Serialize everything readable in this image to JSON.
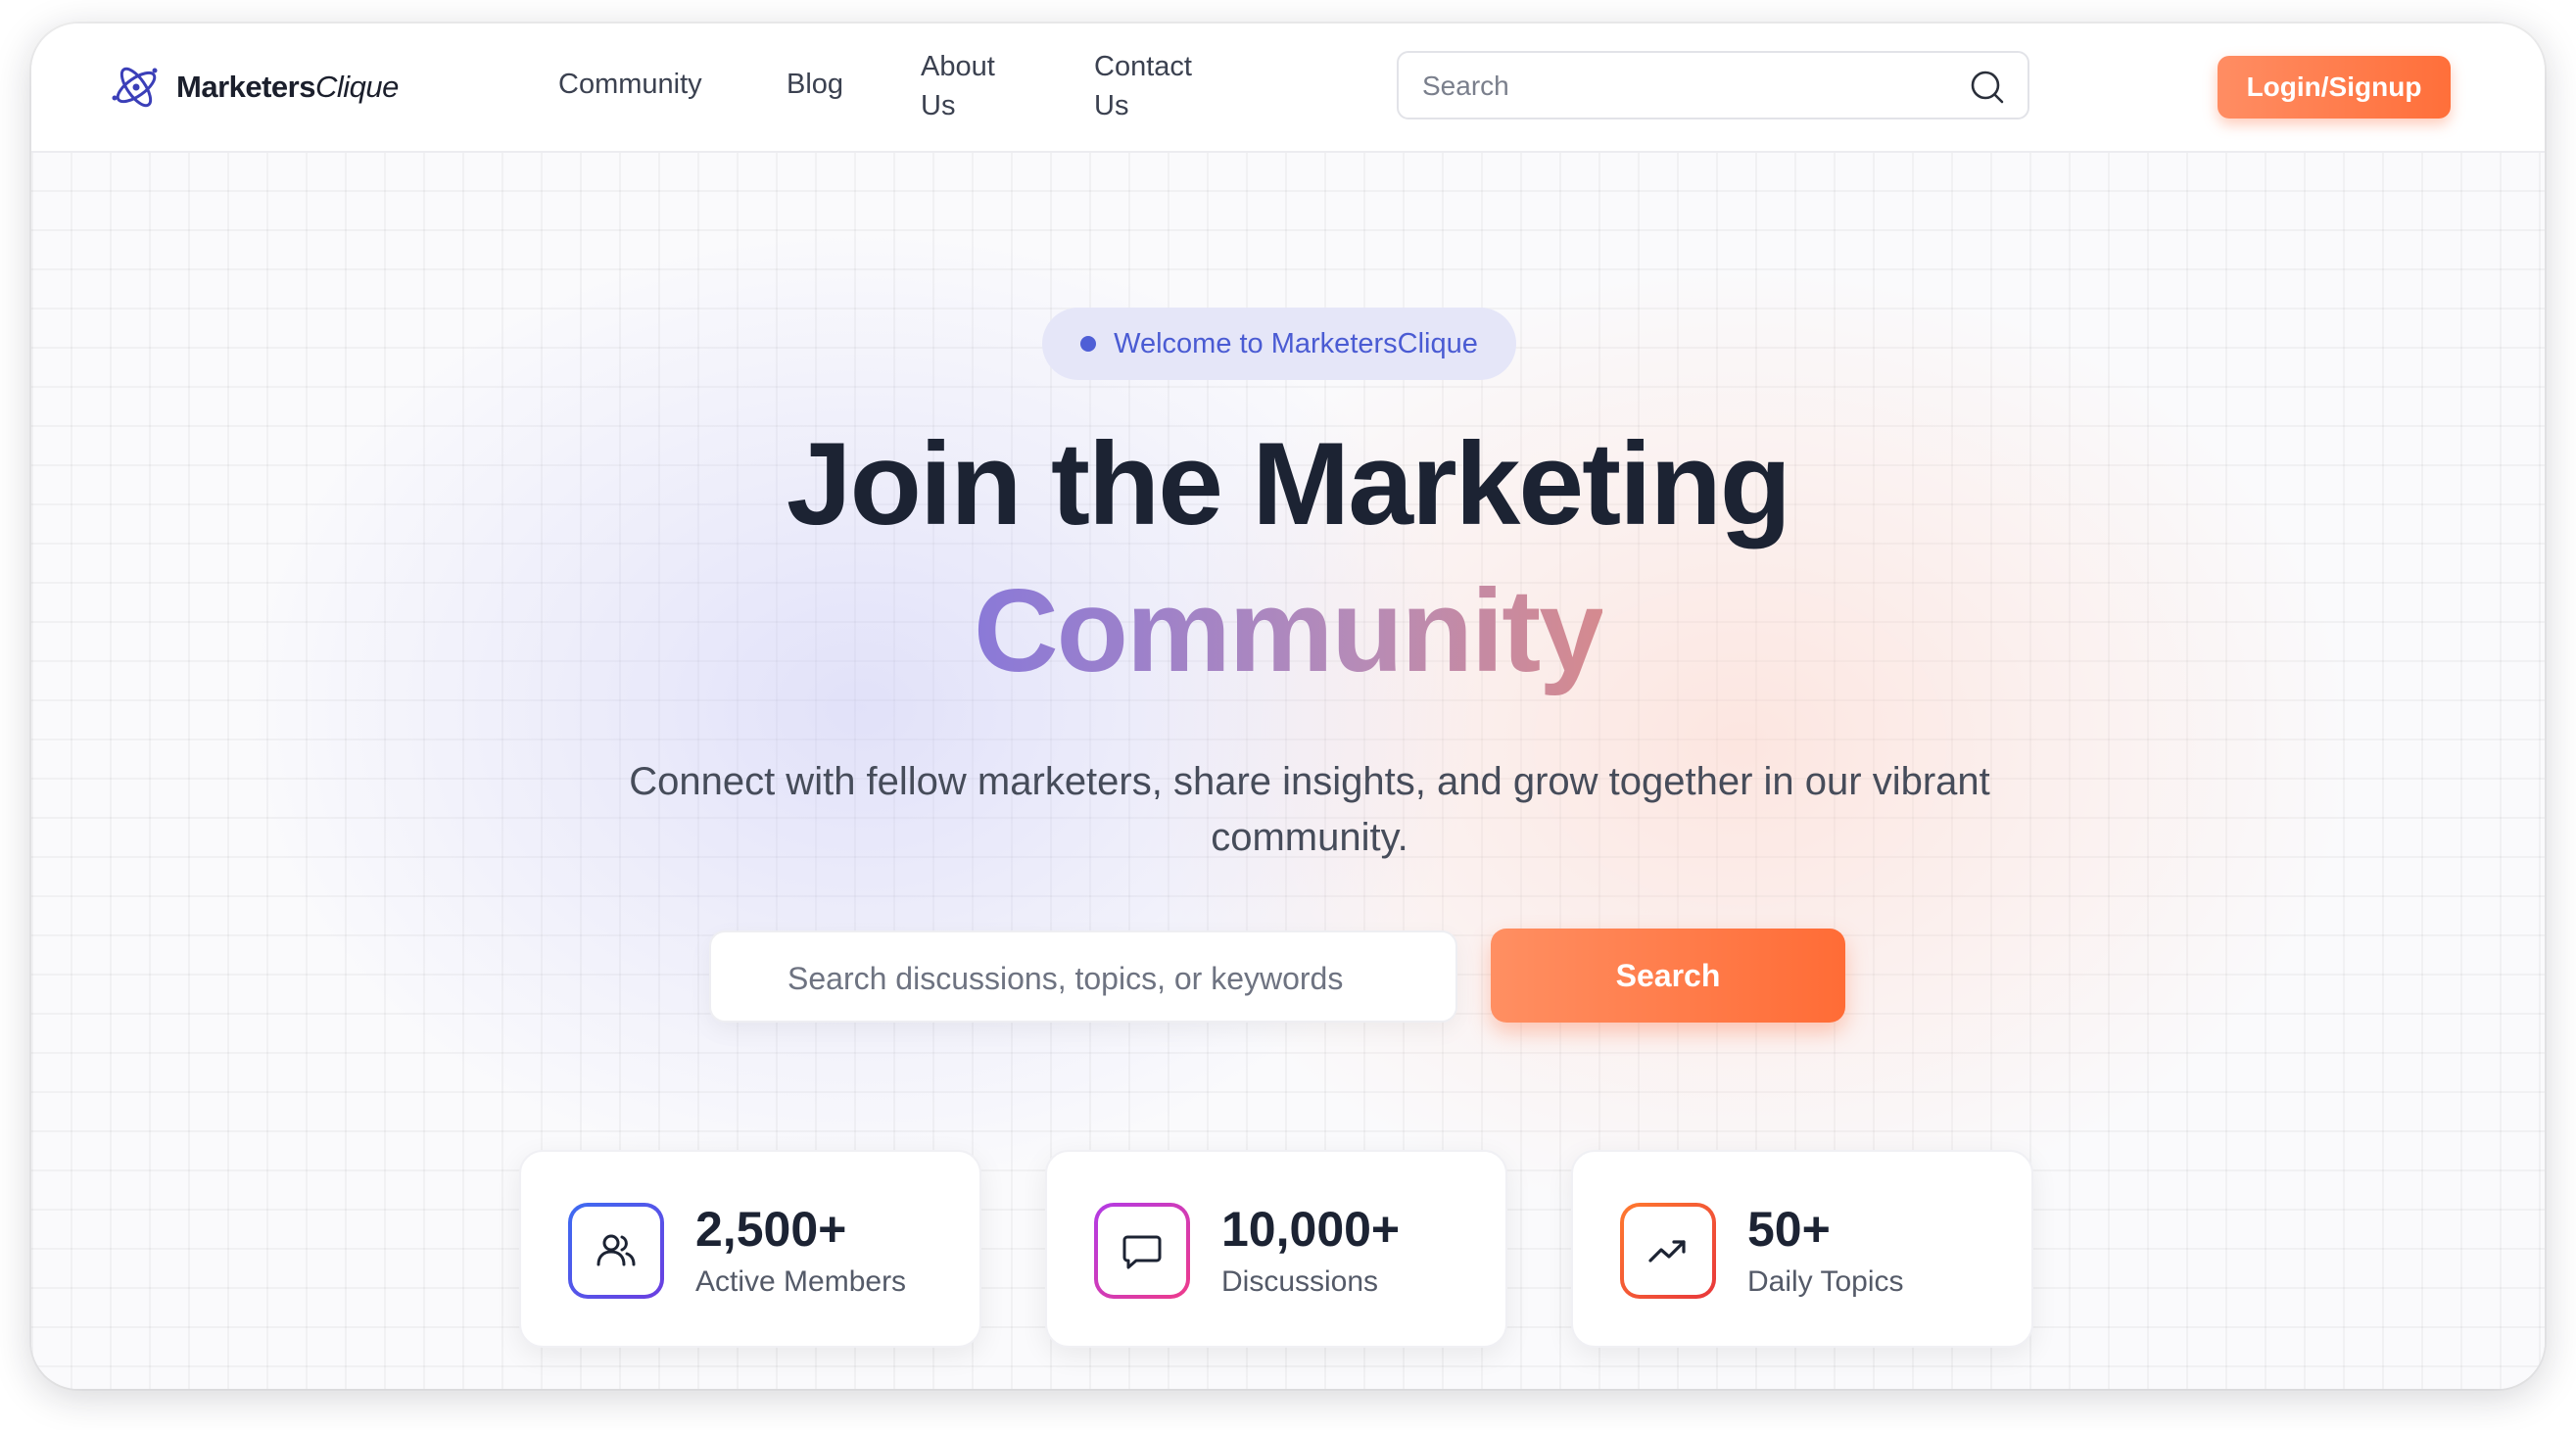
{
  "brand": {
    "name_bold": "Marketers",
    "name_italic": "Clique",
    "logo_icon": "orbit-logo-icon"
  },
  "nav": [
    {
      "label": "Community"
    },
    {
      "label": "Blog"
    },
    {
      "label": "About Us"
    },
    {
      "label": "Contact Us"
    }
  ],
  "header_search": {
    "placeholder": "Search",
    "icon": "search-icon"
  },
  "login_button": {
    "label": "Login/Signup"
  },
  "hero": {
    "badge": "Welcome to MarketersClique",
    "headline_line1": "Join the Marketing",
    "headline_line2": "Community",
    "subtitle": "Connect with fellow marketers, share insights, and grow together in our vibrant community.",
    "search_placeholder": "Search discussions, topics, or keywords",
    "search_button": "Search"
  },
  "stats": [
    {
      "value": "2,500+",
      "label": "Active Members",
      "icon": "users-icon"
    },
    {
      "value": "10,000+",
      "label": "Discussions",
      "icon": "chat-bubble-icon"
    },
    {
      "value": "50+",
      "label": "Daily Topics",
      "icon": "trending-up-icon"
    }
  ],
  "colors": {
    "accent_orange": "#ff7440",
    "accent_blue": "#4f5fd6",
    "text_dark": "#1c2333"
  }
}
